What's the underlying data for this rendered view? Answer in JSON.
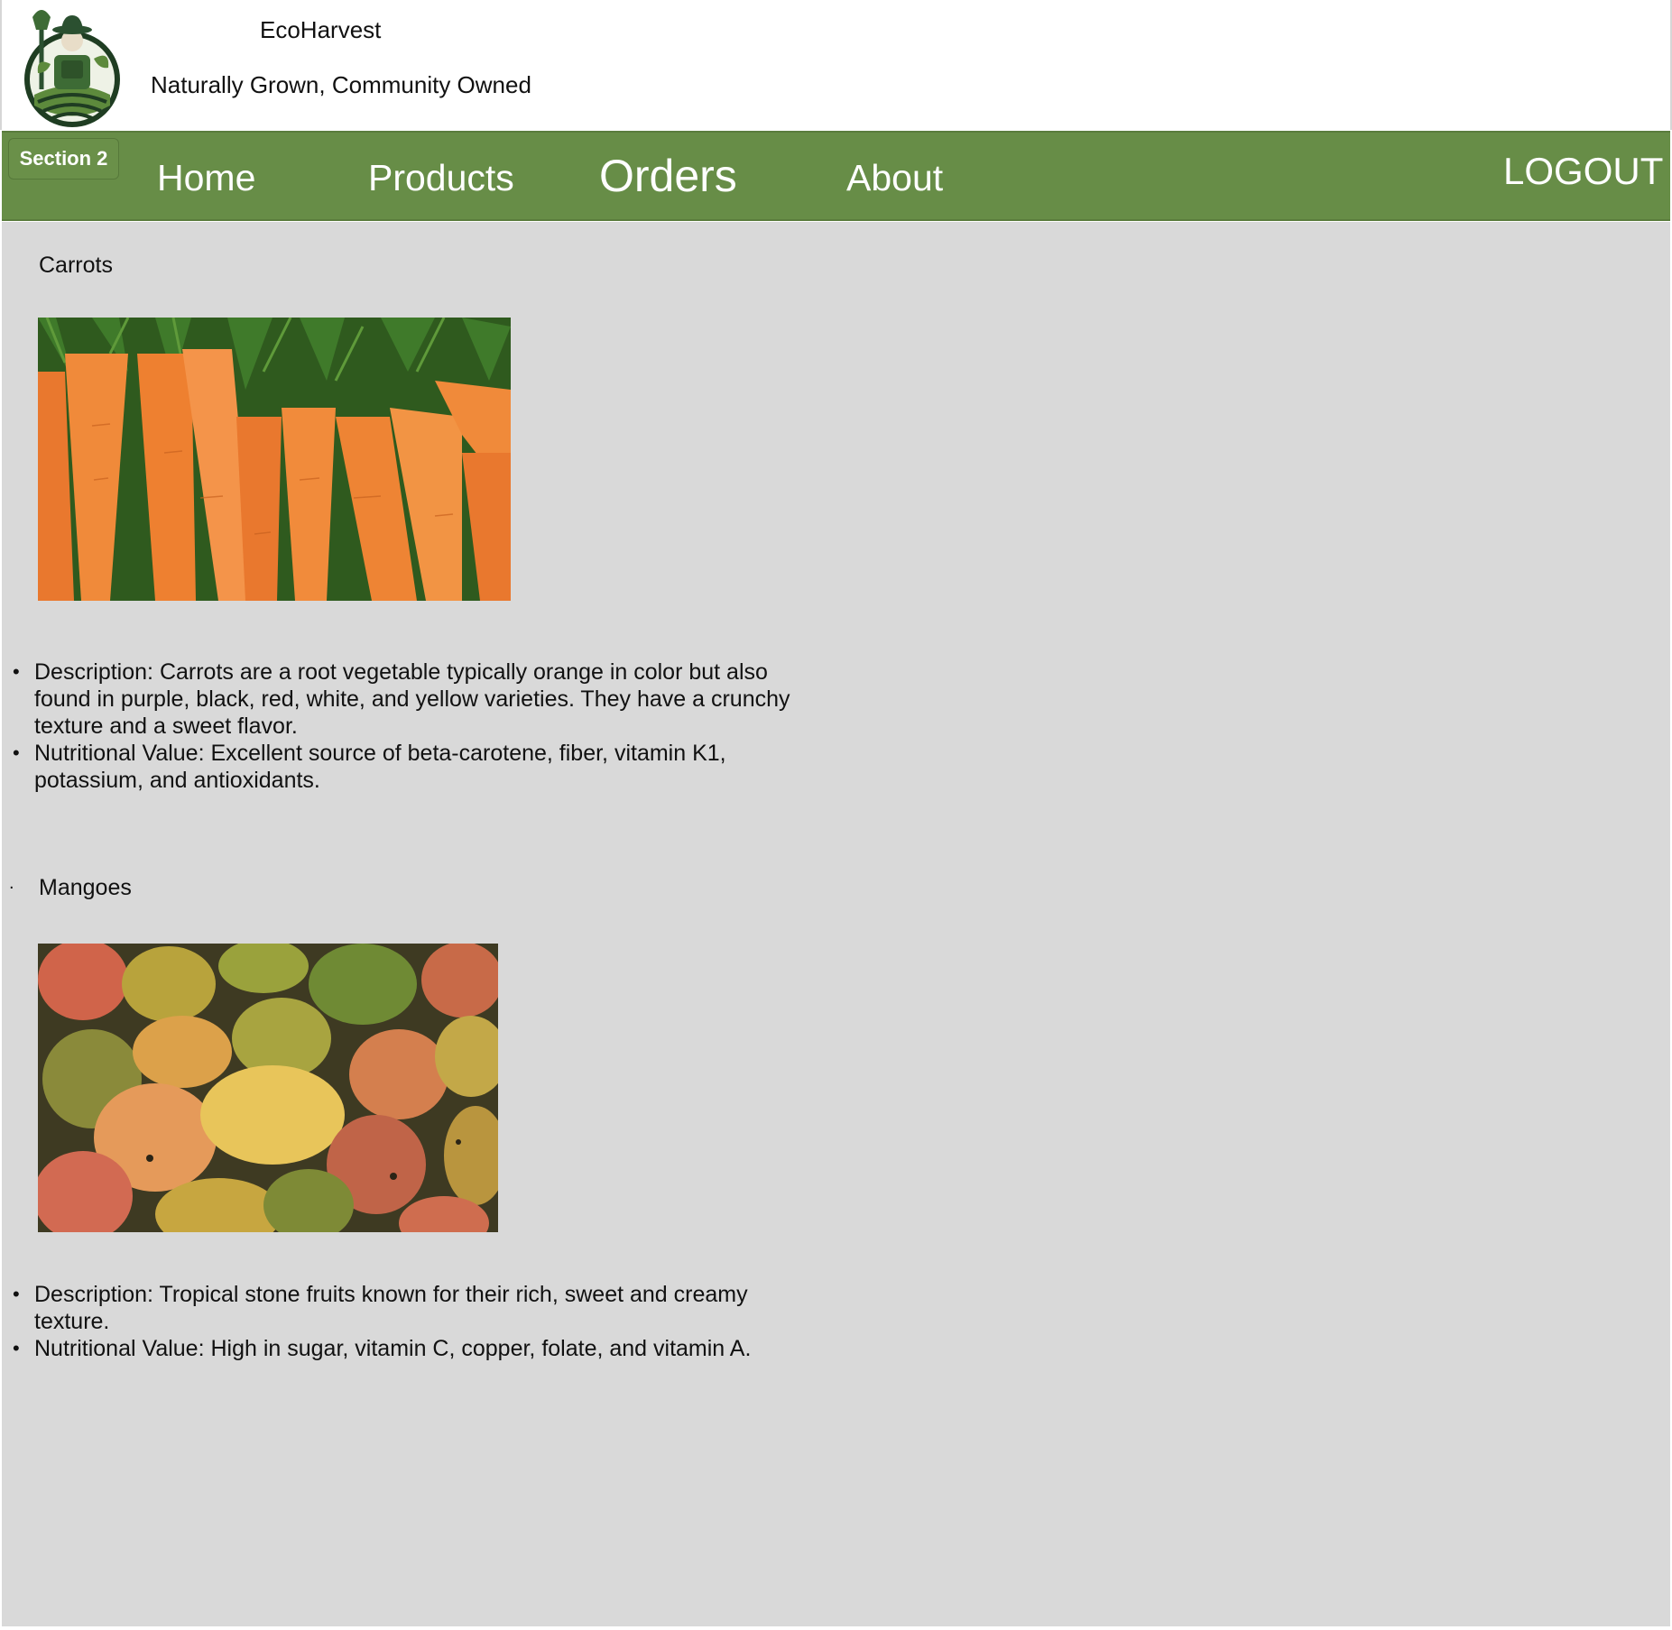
{
  "header": {
    "brand_name": "EcoHarvest",
    "tagline": "Naturally Grown, Community Owned",
    "logo_icon": "farmer-logo-icon"
  },
  "nav": {
    "section_badge": "Section 2",
    "links": {
      "home": "Home",
      "products": "Products",
      "orders": "Orders",
      "about": "About"
    },
    "logout": "LOGOUT"
  },
  "products": [
    {
      "name": "Carrots",
      "image_icon": "carrots-photo",
      "description": "Description: Carrots are a root vegetable typically orange in color but also found in purple, black, red, white, and yellow varieties. They have a crunchy texture and a sweet flavor.",
      "nutrition": "Nutritional Value: Excellent source of beta-carotene, fiber, vitamin K1, potassium, and antioxidants."
    },
    {
      "marker": ".",
      "name": "Mangoes",
      "image_icon": "mangoes-photo",
      "description": "Description: Tropical stone fruits known for their rich, sweet and creamy texture.",
      "nutrition": "Nutritional Value: High in sugar, vitamin C, copper, folate, and vitamin A."
    }
  ],
  "colors": {
    "nav_green": "#678d47",
    "content_bg": "#d9d9d9",
    "header_bg": "#ffffff"
  }
}
